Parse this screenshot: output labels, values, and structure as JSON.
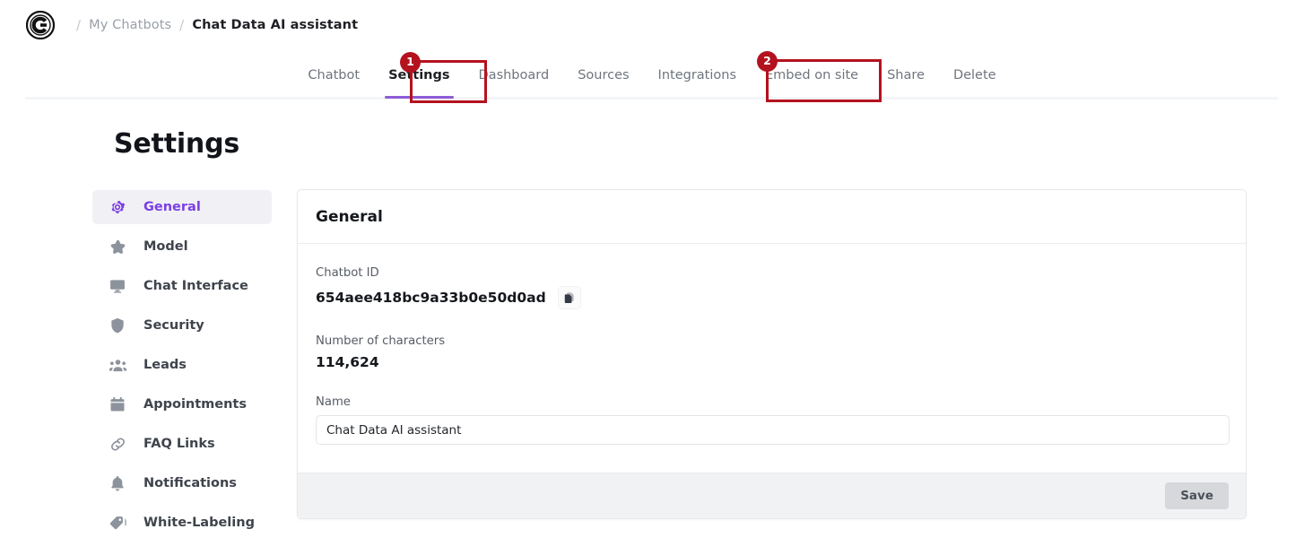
{
  "brand": {
    "logo_icon": "chat-data-c-logo"
  },
  "breadcrumb": {
    "sep": "/",
    "parent": "My Chatbots",
    "current": "Chat Data AI assistant"
  },
  "tabs": [
    {
      "label": "Chatbot",
      "active": false
    },
    {
      "label": "Settings",
      "active": true
    },
    {
      "label": "Dashboard",
      "active": false
    },
    {
      "label": "Sources",
      "active": false
    },
    {
      "label": "Integrations",
      "active": false
    },
    {
      "label": "Embed on site",
      "active": false
    },
    {
      "label": "Share",
      "active": false
    },
    {
      "label": "Delete",
      "active": false
    }
  ],
  "annotations": [
    {
      "number": "1",
      "target": "Settings"
    },
    {
      "number": "2",
      "target": "Embed on site"
    }
  ],
  "page": {
    "title": "Settings"
  },
  "sidebar": {
    "items": [
      {
        "label": "General",
        "icon": "gear-icon",
        "active": true
      },
      {
        "label": "Model",
        "icon": "star-icon",
        "active": false
      },
      {
        "label": "Chat Interface",
        "icon": "monitor-icon",
        "active": false
      },
      {
        "label": "Security",
        "icon": "shield-icon",
        "active": false
      },
      {
        "label": "Leads",
        "icon": "people-icon",
        "active": false
      },
      {
        "label": "Appointments",
        "icon": "calendar-icon",
        "active": false
      },
      {
        "label": "FAQ Links",
        "icon": "link-icon",
        "active": false
      },
      {
        "label": "Notifications",
        "icon": "bell-icon",
        "active": false
      },
      {
        "label": "White-Labeling",
        "icon": "tag-icon",
        "active": false
      }
    ]
  },
  "card": {
    "header": "General",
    "chatbot_id_label": "Chatbot ID",
    "chatbot_id_value": "654aee418bc9a33b0e50d0ad",
    "copy_icon": "copy-icon",
    "characters_label": "Number of characters",
    "characters_value": "114,624",
    "name_label": "Name",
    "name_value": "Chat Data AI assistant",
    "name_placeholder": "Chat Data AI assistant",
    "save_label": "Save"
  },
  "colors": {
    "accent_purple": "#7b3fe4",
    "tab_underline": "#8f5cd6",
    "annotation_red": "#b4121f",
    "muted_text": "#6f757d",
    "footer_bg": "#f1f2f4"
  }
}
